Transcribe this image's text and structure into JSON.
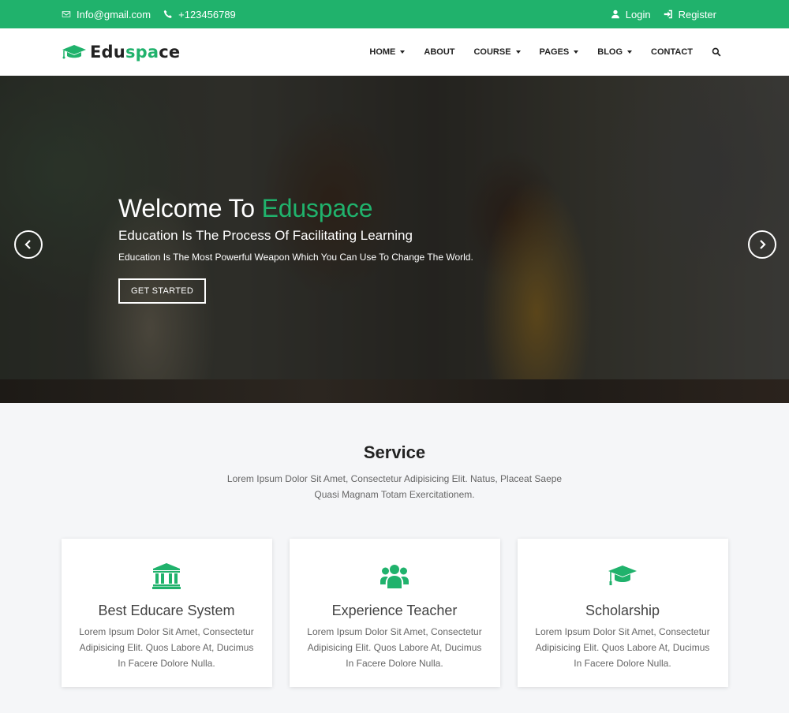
{
  "topbar": {
    "email": "Info@gmail.com",
    "phone": "+123456789",
    "login": "Login",
    "register": "Register",
    "bg_color": "#20b26c"
  },
  "header": {
    "logo_main": "Edu",
    "logo_accent": "spa",
    "logo_end": "ce",
    "nav": [
      {
        "label": "HOME"
      },
      {
        "label": "ABOUT"
      },
      {
        "label": "COURSE"
      },
      {
        "label": "PAGES"
      },
      {
        "label": "BLOG"
      },
      {
        "label": "CONTACT"
      }
    ]
  },
  "hero": {
    "title_prefix": "Welcome To ",
    "title_accent": "Eduspace",
    "subtitle": "Education Is The Process Of Facilitating Learning",
    "description": "Education Is The Most Powerful Weapon Which You Can Use To Change The World.",
    "button": "GET STARTED"
  },
  "service": {
    "title": "Service",
    "description": "Lorem Ipsum Dolor Sit Amet, Consectetur Adipisicing Elit. Natus, Placeat Saepe Quasi Magnam Totam Exercitationem.",
    "cards": [
      {
        "icon": "bank-icon",
        "title": "Best Educare System",
        "text": "Lorem Ipsum Dolor Sit Amet, Consectetur Adipisicing Elit. Quos Labore At, Ducimus In Facere Dolore Nulla."
      },
      {
        "icon": "users-icon",
        "title": "Experience Teacher",
        "text": "Lorem Ipsum Dolor Sit Amet, Consectetur Adipisicing Elit. Quos Labore At, Ducimus In Facere Dolore Nulla."
      },
      {
        "icon": "graduation-cap-icon",
        "title": "Scholarship",
        "text": "Lorem Ipsum Dolor Sit Amet, Consectetur Adipisicing Elit. Quos Labore At, Ducimus In Facere Dolore Nulla."
      }
    ]
  },
  "colors": {
    "accent": "#20b26c",
    "page_bg": "#f5f6f8"
  }
}
